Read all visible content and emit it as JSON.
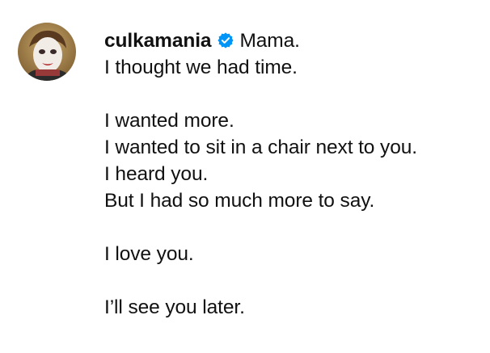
{
  "post": {
    "username": "culkamania",
    "verified_icon": "verified-badge-icon",
    "avatar_icon": "profile-avatar",
    "accent_color": "#0095f6",
    "caption_lines": [
      "Mama.",
      "I thought we had time.",
      "",
      "I wanted more.",
      "I wanted to sit in a chair next to you.",
      "I heard you.",
      "But I had so much more to say.",
      "",
      "I love you.",
      "",
      "I’ll see you later."
    ]
  }
}
